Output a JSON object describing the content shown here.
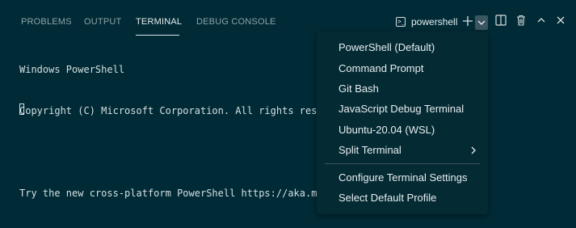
{
  "tabs": [
    {
      "label": "PROBLEMS",
      "active": false
    },
    {
      "label": "OUTPUT",
      "active": false
    },
    {
      "label": "TERMINAL",
      "active": true
    },
    {
      "label": "DEBUG CONSOLE",
      "active": false
    }
  ],
  "toolbar": {
    "terminal_name": "powershell",
    "terminal_icon": "terminal-icon",
    "new_terminal": "+",
    "launch_profile": "chevron-down-icon",
    "split": "split-icon",
    "kill": "trash-icon",
    "maximize": "chevron-up-icon",
    "close": "close-icon"
  },
  "terminal": {
    "lines": [
      "Windows PowerShell",
      "Copyright (C) Microsoft Corporation. All rights reser",
      "",
      "Try the new cross-platform PowerShell https://aka.ms/"
    ]
  },
  "menu": {
    "items": [
      {
        "label": "PowerShell (Default)"
      },
      {
        "label": "Command Prompt"
      },
      {
        "label": "Git Bash"
      },
      {
        "label": "JavaScript Debug Terminal"
      },
      {
        "label": "Ubuntu-20.04 (WSL)"
      },
      {
        "label": "Split Terminal",
        "submenu": true
      }
    ],
    "items2": [
      {
        "label": "Configure Terminal Settings"
      },
      {
        "label": "Select Default Profile"
      }
    ]
  },
  "colors": {
    "background": "#002b36",
    "menu_background": "#042a33",
    "text": "#e7eef0",
    "inactive_tab": "#8fa3a8"
  }
}
